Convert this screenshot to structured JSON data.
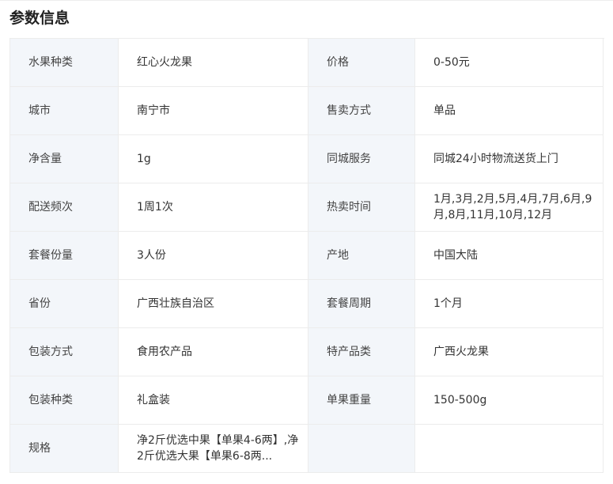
{
  "section_title": "参数信息",
  "rows": [
    {
      "label1": "水果种类",
      "value1": "红心火龙果",
      "label2": "价格",
      "value2": "0-50元"
    },
    {
      "label1": "城市",
      "value1": "南宁市",
      "label2": "售卖方式",
      "value2": "单品"
    },
    {
      "label1": "净含量",
      "value1": "1g",
      "label2": "同城服务",
      "value2": "同城24小时物流送货上门"
    },
    {
      "label1": "配送频次",
      "value1": "1周1次",
      "label2": "热卖时间",
      "value2": "1月,3月,2月,5月,4月,7月,6月,9月,8月,11月,10月,12月"
    },
    {
      "label1": "套餐份量",
      "value1": "3人份",
      "label2": "产地",
      "value2": "中国大陆"
    },
    {
      "label1": "省份",
      "value1": "广西壮族自治区",
      "label2": "套餐周期",
      "value2": "1个月"
    },
    {
      "label1": "包装方式",
      "value1": "食用农产品",
      "label2": "特产品类",
      "value2": "广西火龙果"
    },
    {
      "label1": "包装种类",
      "value1": "礼盒装",
      "label2": "单果重量",
      "value2": "150-500g"
    },
    {
      "label1": "规格",
      "value1": "净2斤优选中果【单果4-6两】,净2斤优选大果【单果6-8两...",
      "label2": "",
      "value2": ""
    }
  ]
}
